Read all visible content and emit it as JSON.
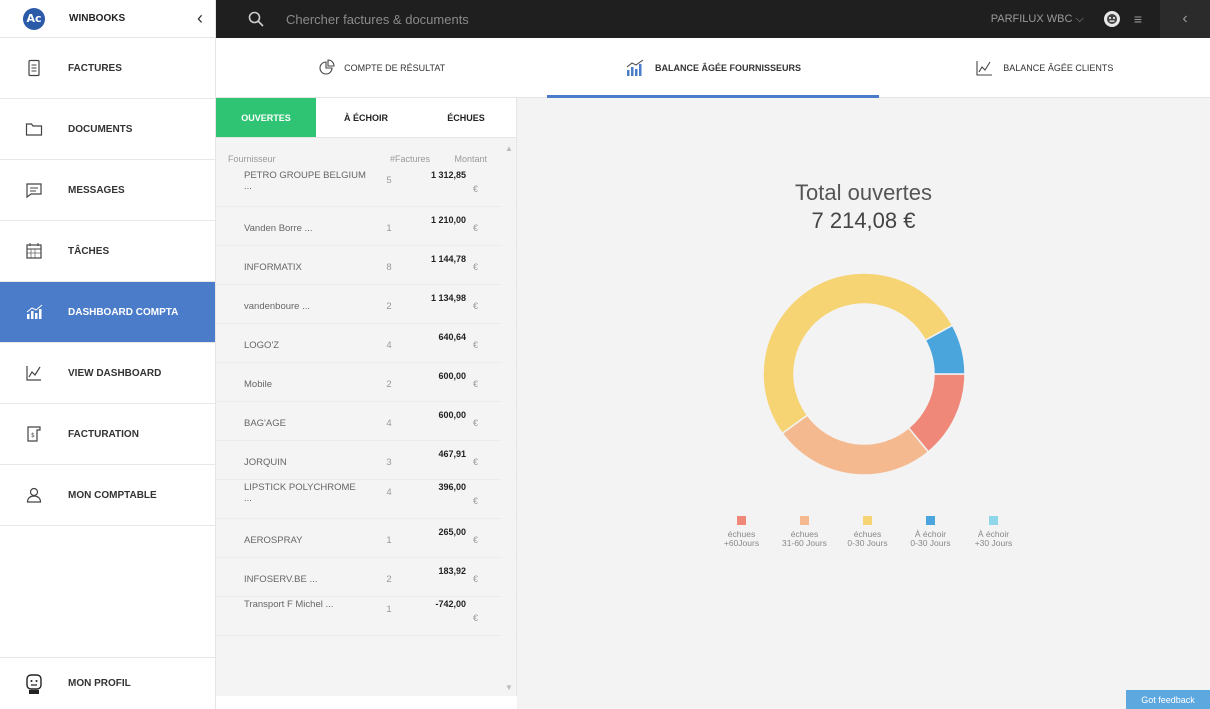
{
  "app": {
    "brand": "WINBOOKS",
    "logo_text": "Ac"
  },
  "sidebar": {
    "items": [
      {
        "label": "FACTURES",
        "icon": "invoice-icon"
      },
      {
        "label": "DOCUMENTS",
        "icon": "folder-icon"
      },
      {
        "label": "MESSAGES",
        "icon": "message-icon"
      },
      {
        "label": "TÂCHES",
        "icon": "calendar-icon"
      },
      {
        "label": "DASHBOARD COMPTA",
        "icon": "bar-chart-icon",
        "active": true
      },
      {
        "label": "VIEW DASHBOARD",
        "icon": "line-chart-icon"
      },
      {
        "label": "FACTURATION",
        "icon": "billing-icon"
      },
      {
        "label": "MON COMPTABLE",
        "icon": "person-icon"
      }
    ],
    "profile": {
      "label": "MON PROFIL",
      "icon": "profile-avatar-icon"
    }
  },
  "topbar": {
    "search_placeholder": "Chercher factures & documents",
    "company": "PARFILUX WBC ⌵"
  },
  "tabs": [
    {
      "label": "COMPTE DE RÉSULTAT"
    },
    {
      "label": "BALANCE ÂGÉE FOURNISSEURS",
      "active": true
    },
    {
      "label": "BALANCE ÂGÉE CLIENTS"
    }
  ],
  "subtabs": [
    {
      "label": "OUVERTES",
      "active": true
    },
    {
      "label": "À ÉCHOIR"
    },
    {
      "label": "ÉCHUES"
    }
  ],
  "list": {
    "headers": {
      "supplier": "Fournisseur",
      "count": "#Factures",
      "amount": "Montant"
    },
    "currency": "€",
    "rows": [
      {
        "supplier": "PETRO GROUPE BELGIUM ...",
        "count": "5",
        "amount": "1 312,85"
      },
      {
        "supplier": "Vanden Borre ...",
        "count": "1",
        "amount": "1 210,00"
      },
      {
        "supplier": "INFORMATIX",
        "count": "8",
        "amount": "1 144,78"
      },
      {
        "supplier": "vandenboure ...",
        "count": "2",
        "amount": "1 134,98"
      },
      {
        "supplier": "LOGO'Z",
        "count": "4",
        "amount": "640,64"
      },
      {
        "supplier": "Mobile",
        "count": "2",
        "amount": "600,00"
      },
      {
        "supplier": "BAG'AGE",
        "count": "4",
        "amount": "600,00"
      },
      {
        "supplier": "JORQUIN",
        "count": "3",
        "amount": "467,91"
      },
      {
        "supplier": "LIPSTICK POLYCHROME ...",
        "count": "4",
        "amount": "396,00"
      },
      {
        "supplier": "AEROSPRAY",
        "count": "1",
        "amount": "265,00"
      },
      {
        "supplier": "INFOSERV.BE ...",
        "count": "2",
        "amount": "183,92"
      },
      {
        "supplier": "Transport F Michel ...",
        "count": "1",
        "amount": "-742,00"
      }
    ]
  },
  "summary": {
    "label": "Total ouvertes",
    "value": "7 214,08  €"
  },
  "chart_data": {
    "type": "pie",
    "series": [
      {
        "name": "échues +60Jours",
        "value": 14,
        "color": "#f0887a"
      },
      {
        "name": "échues 31-60 Jours",
        "value": 26,
        "color": "#f4b98e"
      },
      {
        "name": "échues 0-30 Jours",
        "value": 52,
        "color": "#f6d474"
      },
      {
        "name": "À échoir 0-30 Jours",
        "value": 8,
        "color": "#4aa5dd"
      },
      {
        "name": "À échoir +30 Jours",
        "value": 0,
        "color": "#8fd6ea"
      }
    ],
    "legend": [
      {
        "line1": "échues",
        "line2": "+60Jours",
        "color": "#f0887a"
      },
      {
        "line1": "échues",
        "line2": "31-60 Jours",
        "color": "#f4b98e"
      },
      {
        "line1": "échues",
        "line2": "0-30 Jours",
        "color": "#f6d474"
      },
      {
        "line1": "À échoir",
        "line2": "0-30 Jours",
        "color": "#4aa5dd"
      },
      {
        "line1": "À échoir",
        "line2": "+30 Jours",
        "color": "#8fd6ea"
      }
    ]
  },
  "feedback": {
    "label": "Got feedback"
  }
}
